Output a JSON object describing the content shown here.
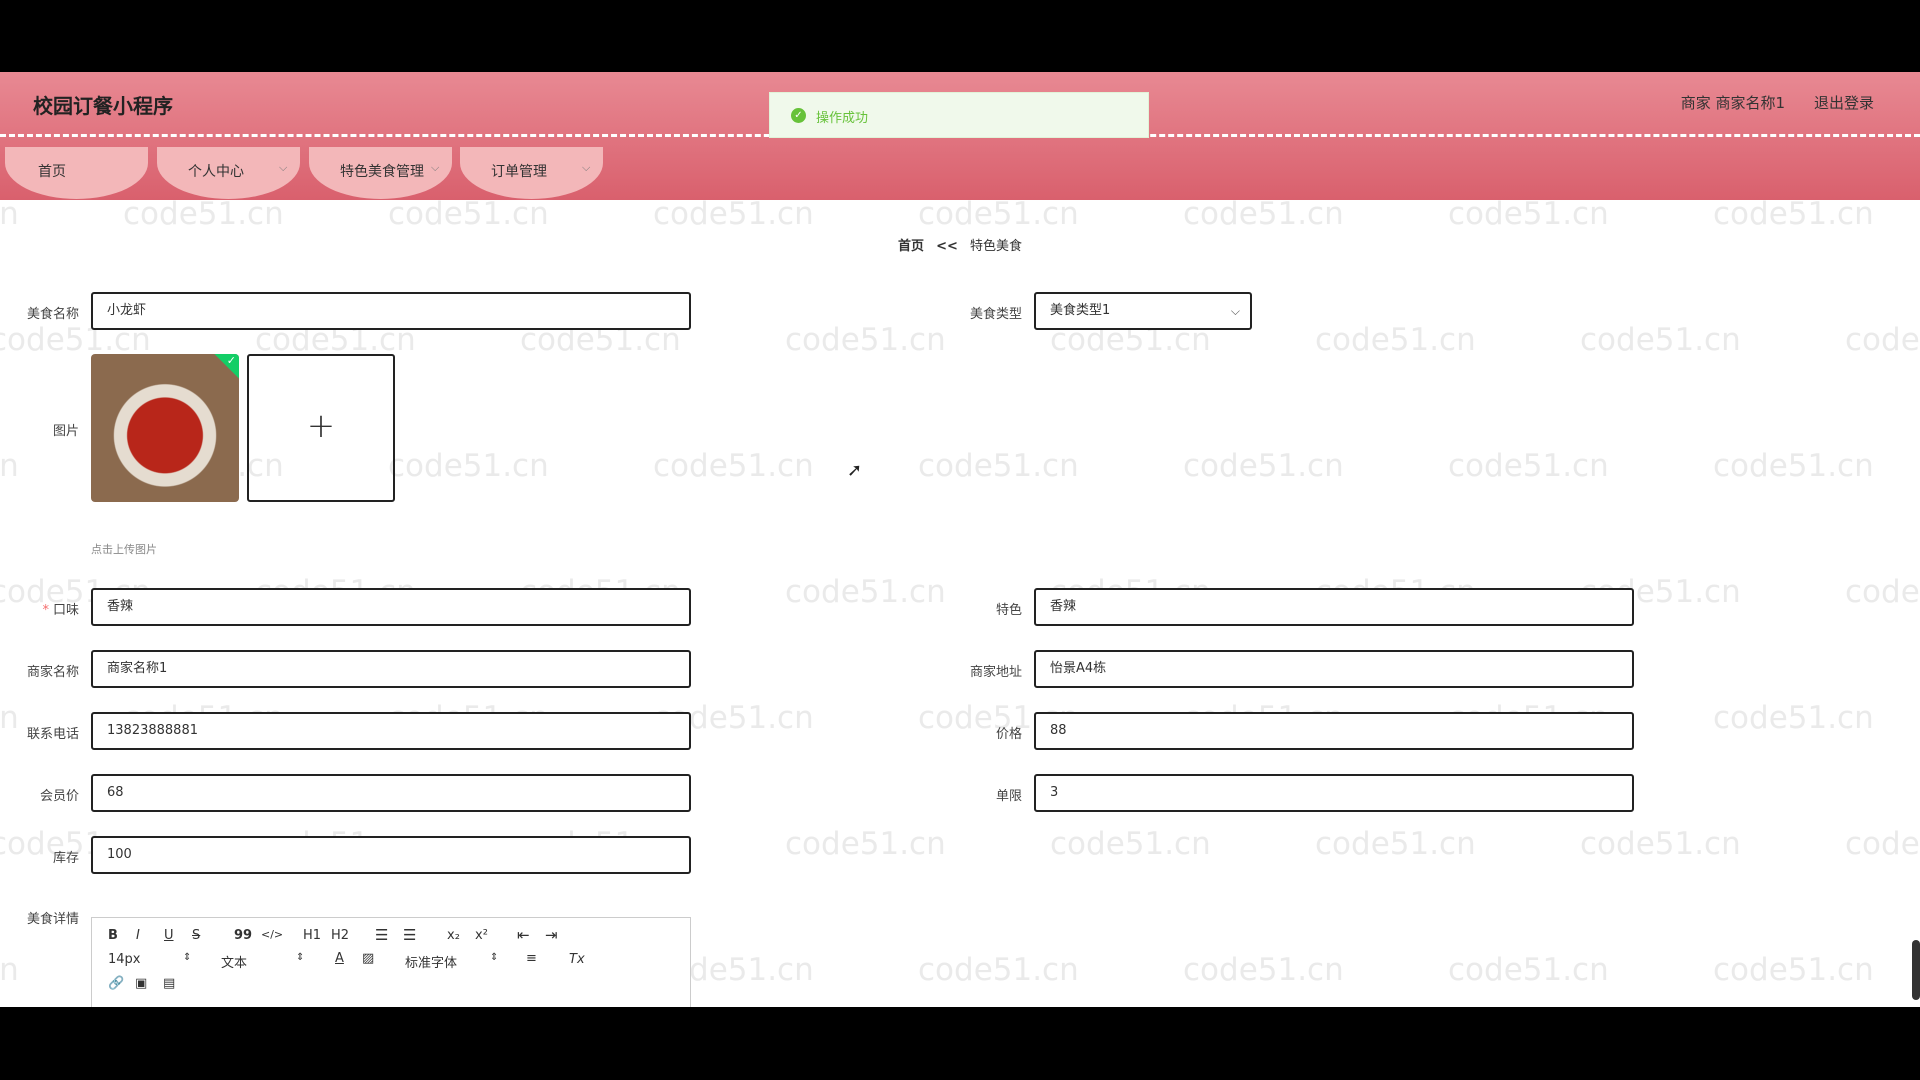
{
  "header": {
    "app_title": "校园订餐小程序",
    "merchant_label": "商家 商家名称1",
    "logout": "退出登录",
    "toast": "操作成功"
  },
  "nav": {
    "home": "首页",
    "personal": "个人中心",
    "food_mgmt": "特色美食管理",
    "order_mgmt": "订单管理"
  },
  "breadcrumb": {
    "home": "首页",
    "sep": "<<",
    "current": "特色美食"
  },
  "form": {
    "food_name": {
      "label": "美食名称",
      "value": "小龙虾"
    },
    "food_type": {
      "label": "美食类型",
      "value": "美食类型1"
    },
    "image": {
      "label": "图片",
      "tip": "点击上传图片"
    },
    "taste": {
      "label": "口味",
      "required_mark": "*",
      "value": "香辣"
    },
    "feature": {
      "label": "特色",
      "value": "香辣"
    },
    "merchant_name": {
      "label": "商家名称",
      "value": "商家名称1"
    },
    "merchant_addr": {
      "label": "商家地址",
      "value": "怡景A4栋"
    },
    "phone": {
      "label": "联系电话",
      "value": "13823888881"
    },
    "price": {
      "label": "价格",
      "value": "88"
    },
    "member_price": {
      "label": "会员价",
      "value": "68"
    },
    "limit": {
      "label": "单限",
      "value": "3"
    },
    "stock": {
      "label": "库存",
      "value": "100"
    },
    "detail": {
      "label": "美食详情"
    }
  },
  "editor": {
    "bold": "B",
    "italic": "I",
    "underline": "U",
    "strike": "S",
    "quote": "99",
    "code": "</>",
    "h1": "H1",
    "h2": "H2",
    "sub": "x₂",
    "sup": "x²",
    "size": "14px",
    "block": "文本",
    "font": "标准字体",
    "clear": "Tx"
  },
  "watermark": "code51.cn",
  "colors": {
    "header_top": "#e88993",
    "header_bottom": "#d9606d",
    "nav_tab": "#f3b7b9",
    "success": "#67c23a"
  }
}
